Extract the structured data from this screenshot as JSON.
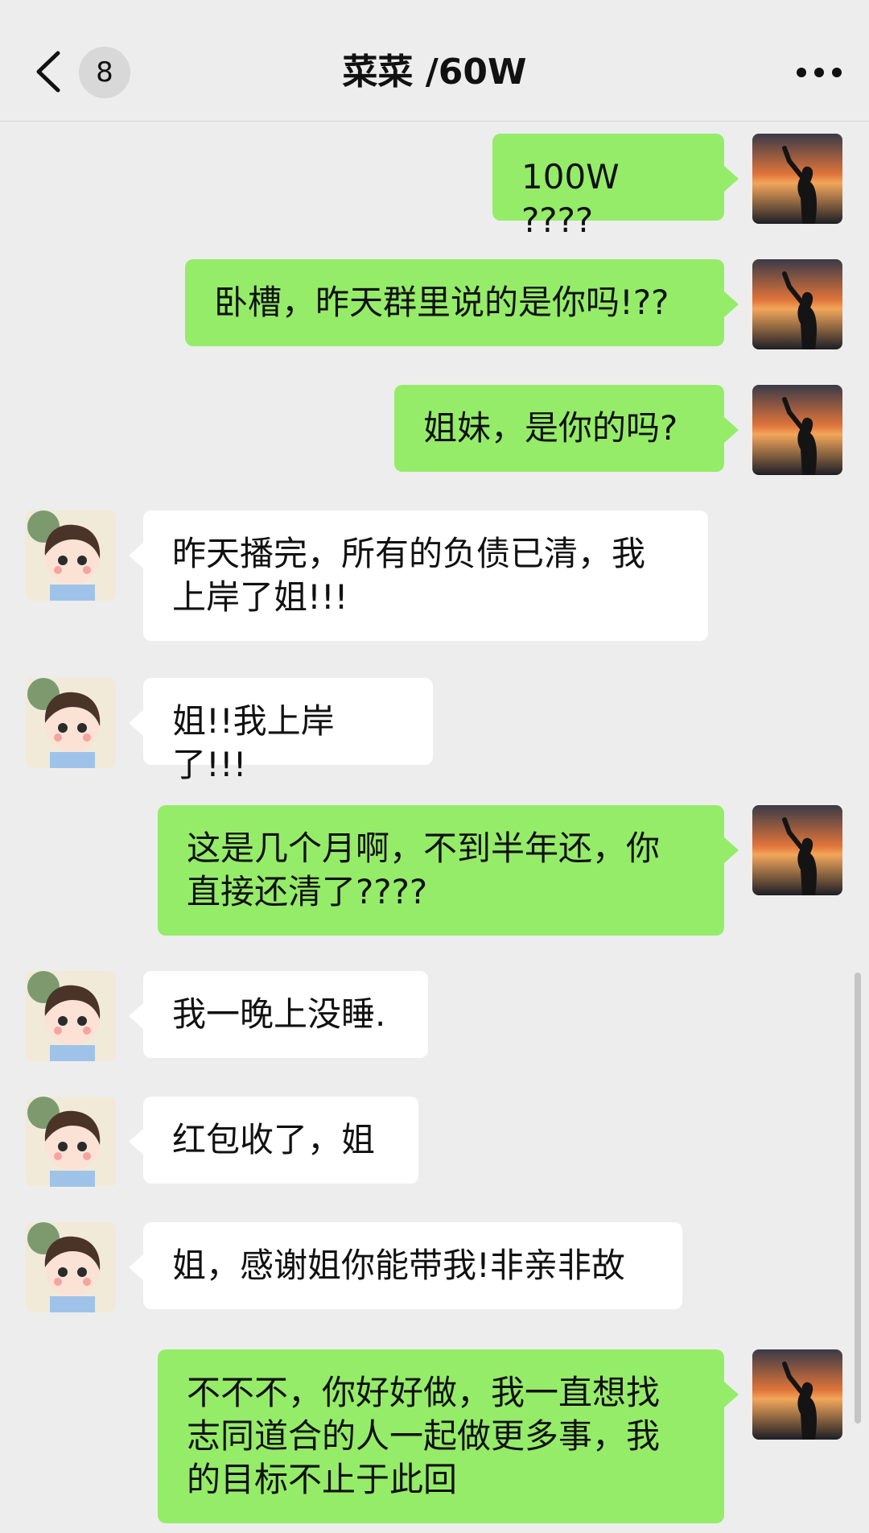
{
  "header": {
    "title": "菜菜 /60W",
    "unread_badge": "8",
    "back_icon": "chevron-left-icon",
    "more_icon": "more-dots-icon"
  },
  "colors": {
    "background": "#ededed",
    "my_bubble": "#95ec69",
    "their_bubble": "#ffffff"
  },
  "messages": [
    {
      "from": "me",
      "text": "100W ????"
    },
    {
      "from": "me",
      "text": "卧槽，昨天群里说的是你吗!??"
    },
    {
      "from": "me",
      "text": "姐妹，是你的吗?"
    },
    {
      "from": "other",
      "text": "昨天播完，所有的负债已清，我\n上岸了姐!!!"
    },
    {
      "from": "other",
      "text": "姐!!我上岸了!!!"
    },
    {
      "from": "me",
      "text": "这是几个月啊，不到半年还，你\n直接还清了????"
    },
    {
      "from": "other",
      "text": "我一晚上没睡."
    },
    {
      "from": "other",
      "text": "红包收了，姐"
    },
    {
      "from": "other",
      "text": "姐，感谢姐你能带我!非亲非故"
    },
    {
      "from": "me",
      "text": "不不不，你好好做，我一直想找\n志同道合的人一起做更多事，我\n的目标不止于此回"
    }
  ]
}
